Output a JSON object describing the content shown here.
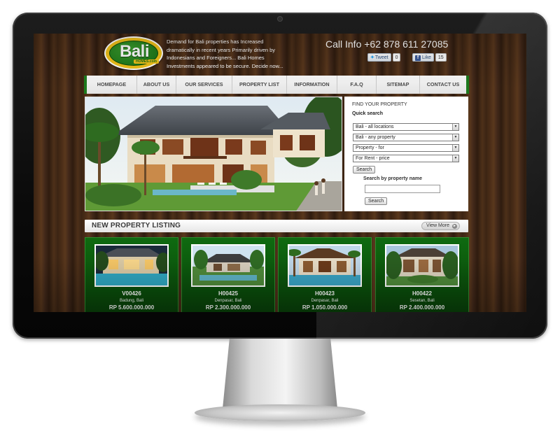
{
  "header": {
    "logo_text": "Bali",
    "logo_sub": "HOMES.com",
    "tagline": "Demand for Bali properties has Increased dramatically in recent years Primarily driven by Indonesians and Foreigners... Bali Homes Investments appeared to be secure. Decide now...",
    "phone": "Call Info +62 878 611 27085",
    "tweet_label": "Tweet",
    "tweet_count": "0",
    "like_label": "Like",
    "like_count": "15"
  },
  "nav": {
    "items": [
      "HOMEPAGE",
      "ABOUT US",
      "OUR SERVICES",
      "PROPERTY LIST",
      "INFORMATION",
      "F.A.Q",
      "SITEMAP",
      "CONTACT US"
    ]
  },
  "search": {
    "title": "FIND YOUR PROPERTY",
    "subtitle": "Quick search",
    "location": "Bali - all locations",
    "property": "Bali - any property",
    "purpose": "Property - for",
    "price": "For Rent - price",
    "search_button": "Search",
    "name_label": "Search by property name",
    "name_value": "",
    "name_button": "Search"
  },
  "listing": {
    "title": "NEW PROPERTY LISTING",
    "view_more": "View More",
    "cards": [
      {
        "code": "V00426",
        "location": "Badung, Bali",
        "price": "RP 5.600.000.000"
      },
      {
        "code": "H00425",
        "location": "Denpasar, Bali",
        "price": "RP 2.300.000.000"
      },
      {
        "code": "H00423",
        "location": "Denpasar, Bali",
        "price": "RP 1.050.000.000"
      },
      {
        "code": "H00422",
        "location": "Sesetan, Bali",
        "price": "RP 2.400.000.000"
      }
    ]
  },
  "colors": {
    "brand_green": "#176d14",
    "brand_yellow": "#f1c21a",
    "wood": "#4a2d17"
  }
}
